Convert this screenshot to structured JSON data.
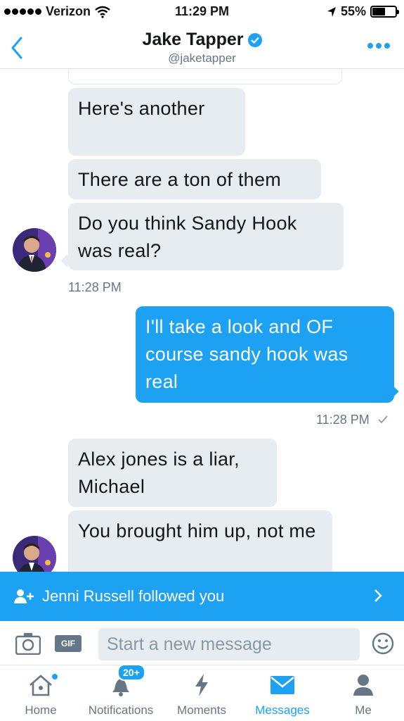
{
  "status_bar": {
    "carrier": "Verizon",
    "time": "11:29 PM",
    "battery": "55%",
    "battery_level": 0.55
  },
  "header": {
    "name": "Jake Tapper",
    "handle": "@jaketapper"
  },
  "messages": [
    {
      "direction": "in",
      "text": "Here's another"
    },
    {
      "direction": "in",
      "text": "There are a ton of them"
    },
    {
      "direction": "in",
      "text": "Do you think Sandy Hook was real?"
    },
    {
      "direction": "in",
      "text": "Alex jones is a liar, Michael"
    },
    {
      "direction": "in",
      "text": "You brought him up, not me"
    },
    {
      "direction": "out",
      "text": "I'll take a look and OF course sandy hook was real"
    }
  ],
  "timestamps": {
    "incoming": "11:28 PM",
    "outgoing": "11:28 PM"
  },
  "banner": {
    "text": "Jenni Russell followed you"
  },
  "composer": {
    "placeholder": "Start a new message",
    "gif_label": "GIF"
  },
  "tabs": [
    {
      "label": "Home"
    },
    {
      "label": "Notifications",
      "badge": "20+"
    },
    {
      "label": "Moments"
    },
    {
      "label": "Messages"
    },
    {
      "label": "Me"
    }
  ],
  "colors": {
    "accent": "#1da1f2",
    "bubble_in": "#e6ecf0",
    "muted": "#657786"
  }
}
